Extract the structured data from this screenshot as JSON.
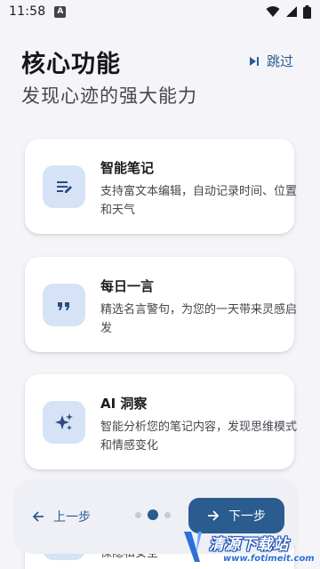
{
  "status_bar": {
    "time": "11:58",
    "notification_letter": "A"
  },
  "header": {
    "title": "核心功能",
    "subtitle": "发现心迹的强大能力",
    "skip_label": "跳过"
  },
  "features": [
    {
      "icon": "notes-edit-icon",
      "title": "智能笔记",
      "description": "支持富文本编辑，自动记录时间、位置和天气"
    },
    {
      "icon": "quote-icon",
      "title": "每日一言",
      "description": "精选名言警句，为您的一天带来灵感启发"
    },
    {
      "icon": "sparkle-icon",
      "title": "AI 洞察",
      "description": "智能分析您的笔记内容，发现思维模式和情感变化"
    },
    {
      "icon": "lock-icon",
      "title": "",
      "description": "保隐私安全"
    }
  ],
  "navigation": {
    "prev_label": "上一步",
    "next_label": "下一步",
    "page_count": 3,
    "current_page": 2
  },
  "watermark": {
    "cn": "清源下载站",
    "en": "www.fotimeit.com"
  },
  "colors": {
    "accent": "#2b5c8f",
    "icon_tile": "#d6e3f7",
    "background": "#f5f5f9"
  }
}
